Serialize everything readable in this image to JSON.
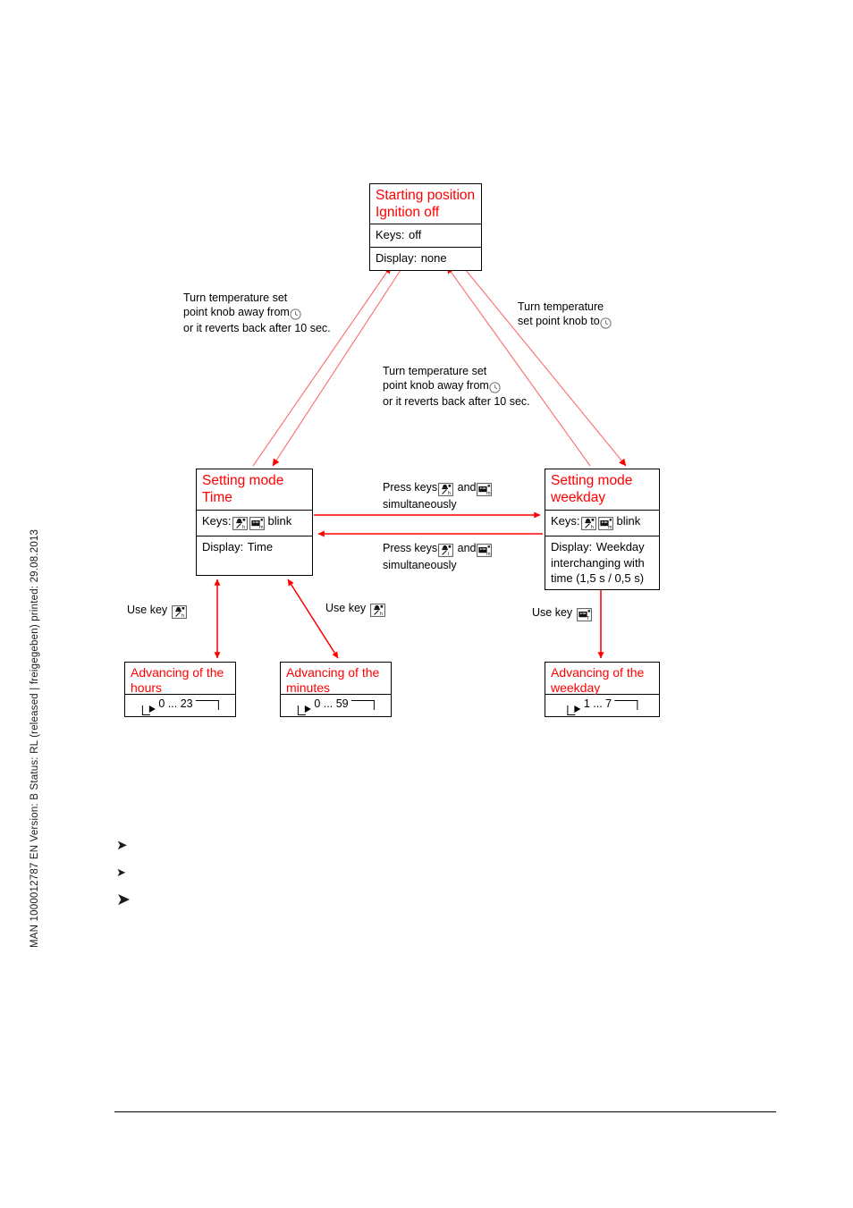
{
  "document": {
    "side_caption": "MAN  1000012787  EN  Version: B  Status: RL (released | freigegeben)  printed: 29.08.2013"
  },
  "diagram": {
    "boxes": {
      "start": {
        "title": "Starting position\nIgnition off",
        "title_line1": "Starting position",
        "title_line2": "Ignition off",
        "keys_label": "Keys:",
        "keys_value": "off",
        "display_label": "Display:",
        "display_value": "none"
      },
      "time": {
        "title_line1": "Setting mode",
        "title_line2": "Time",
        "keys_label": "Keys:",
        "keys_value": "blink",
        "display_label": "Display:",
        "display_value": "Time"
      },
      "weekday": {
        "title_line1": "Setting mode",
        "title_line2": "weekday",
        "keys_label": "Keys:",
        "keys_value": "blink",
        "display_label": "Display:",
        "display_value_line1": "Weekday",
        "display_value_line2": "interchanging with",
        "display_value_line3": "time  (1,5 s / 0,5 s)"
      },
      "adv_hours": {
        "title_line1": "Advancing of the",
        "title_line2": "hours",
        "range": "0 ... 23"
      },
      "adv_minutes": {
        "title_line1": "Advancing of the",
        "title_line2": "minutes",
        "range": "0 ... 59"
      },
      "adv_weekday": {
        "title_line1": "Advancing of the",
        "title_line2": "weekday",
        "range": "1 ... 7"
      }
    },
    "annotations": {
      "left_transition": {
        "line1": "Turn temperature set",
        "line2_pre": "point knob away from",
        "line3": "or it reverts back after 10 sec."
      },
      "right_transition": {
        "line1": "Turn temperature",
        "line2_pre": "set point knob to"
      },
      "mid_transition": {
        "line1": "Turn temperature set",
        "line2_pre": "point knob away from",
        "line3": "or it reverts back after 10 sec."
      },
      "press_keys_top": {
        "pre": "Press keys",
        "mid": "and",
        "line2": "simultaneously"
      },
      "press_keys_bottom": {
        "pre": "Press keys",
        "mid": "and",
        "line2": "simultaneously"
      },
      "use_key_hours": "Use key",
      "use_key_minutes": "Use key",
      "use_key_weekday": "Use key"
    },
    "icons": {
      "clock": "clock-icon",
      "key_hours": "key-hours-icon",
      "key_minutes": "key-minutes-icon",
      "key_weekday": "key-weekday-icon"
    },
    "colors": {
      "accent_red": "#ff0000",
      "arrow_red": "#ff3b30",
      "text_black": "#000000"
    }
  },
  "bullets": {
    "items": [
      "➤",
      "➤",
      "➤"
    ]
  }
}
